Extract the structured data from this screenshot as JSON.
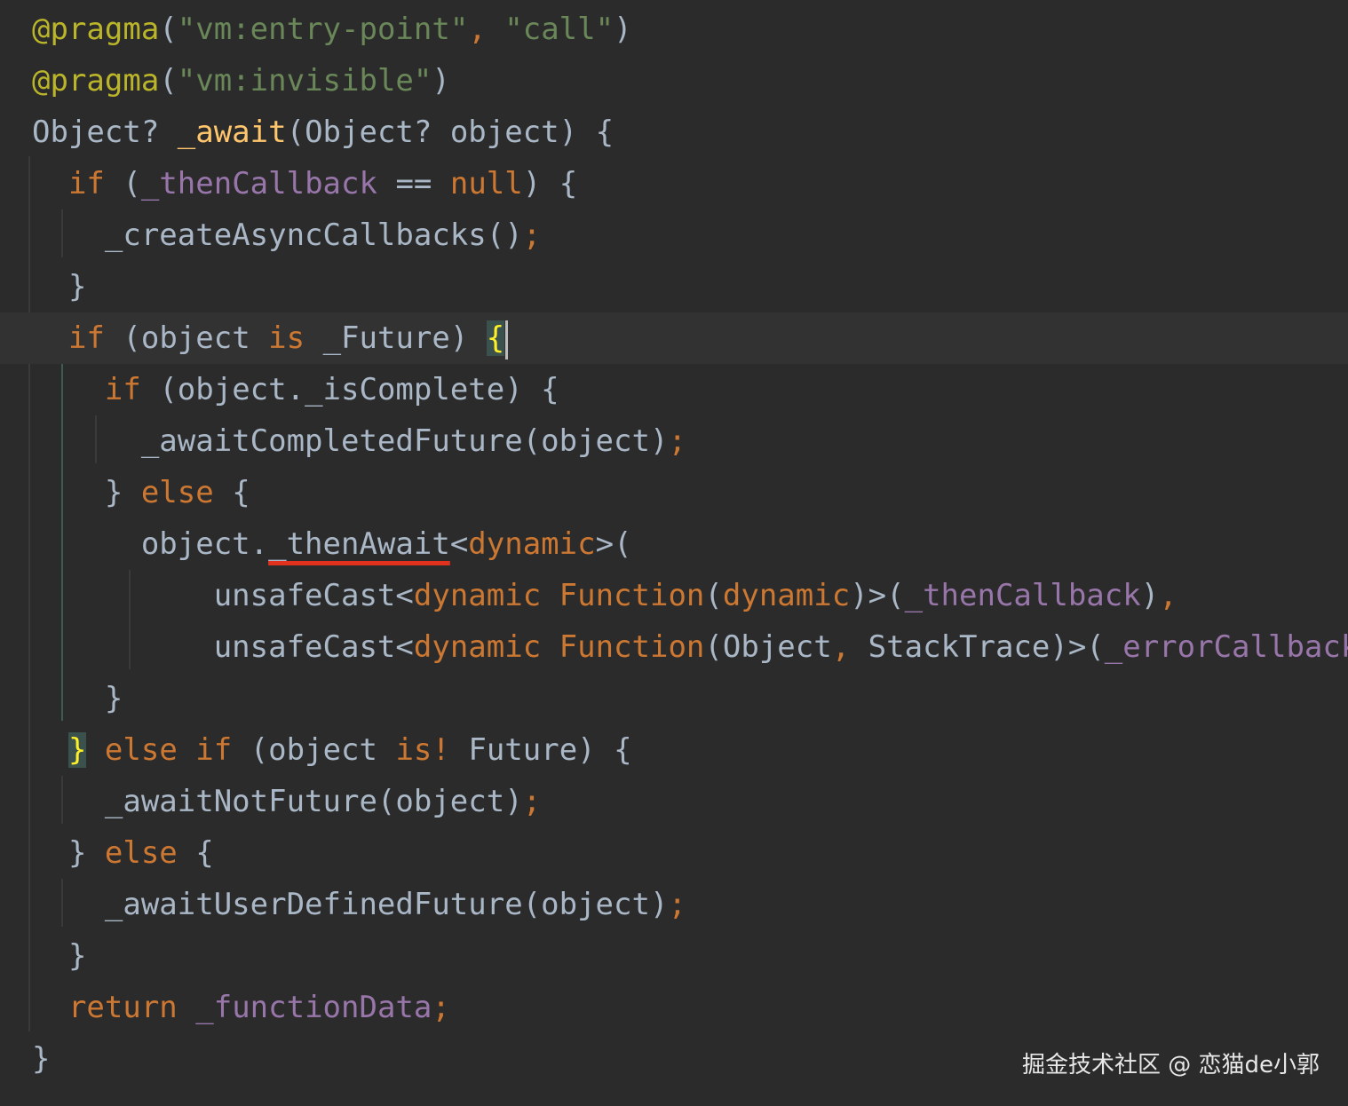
{
  "editor": {
    "language": "Dart",
    "theme_colors": {
      "background": "#2b2b2b",
      "default_text": "#a9b7c6",
      "keyword": "#cc7832",
      "string": "#6a8759",
      "annotation": "#bbb529",
      "function_name": "#ffc66d",
      "field": "#9876aa",
      "current_line": "#323232",
      "underline_mark": "#e0311f"
    },
    "lines": [
      {
        "tokens": [
          {
            "t": "@pragma",
            "c": "ann"
          },
          {
            "t": "(",
            "c": "tok"
          },
          {
            "t": "\"vm:entry-point\"",
            "c": "str"
          },
          {
            "t": ", ",
            "c": "kw"
          },
          {
            "t": "\"call\"",
            "c": "str"
          },
          {
            "t": ")",
            "c": "tok"
          }
        ]
      },
      {
        "tokens": [
          {
            "t": "@pragma",
            "c": "ann"
          },
          {
            "t": "(",
            "c": "tok"
          },
          {
            "t": "\"vm:invisible\"",
            "c": "str"
          },
          {
            "t": ")",
            "c": "tok"
          }
        ]
      },
      {
        "tokens": [
          {
            "t": "Object? ",
            "c": "tok"
          },
          {
            "t": "_await",
            "c": "fn"
          },
          {
            "t": "(Object? object) {",
            "c": "tok"
          }
        ]
      },
      {
        "tokens": [
          {
            "t": "  ",
            "c": "tok"
          },
          {
            "t": "if",
            "c": "kw"
          },
          {
            "t": " (",
            "c": "tok"
          },
          {
            "t": "_thenCallback",
            "c": "fld"
          },
          {
            "t": " == ",
            "c": "tok"
          },
          {
            "t": "null",
            "c": "kw"
          },
          {
            "t": ") {",
            "c": "tok"
          }
        ]
      },
      {
        "tokens": [
          {
            "t": "    _createAsyncCallbacks()",
            "c": "tok"
          },
          {
            "t": ";",
            "c": "kw"
          }
        ]
      },
      {
        "tokens": [
          {
            "t": "  }",
            "c": "tok"
          }
        ]
      },
      {
        "current": true,
        "tokens": [
          {
            "t": "  ",
            "c": "tok"
          },
          {
            "t": "if",
            "c": "kw"
          },
          {
            "t": " (object ",
            "c": "tok"
          },
          {
            "t": "is",
            "c": "kw"
          },
          {
            "t": " _Future) ",
            "c": "tok"
          },
          {
            "t": "{",
            "c": "match"
          },
          {
            "t": "",
            "c": "caret"
          }
        ]
      },
      {
        "tokens": [
          {
            "t": "    ",
            "c": "tok"
          },
          {
            "t": "if",
            "c": "kw"
          },
          {
            "t": " (object._isComplete) {",
            "c": "tok"
          }
        ]
      },
      {
        "tokens": [
          {
            "t": "      _awaitCompletedFuture(object)",
            "c": "tok"
          },
          {
            "t": ";",
            "c": "kw"
          }
        ]
      },
      {
        "tokens": [
          {
            "t": "    } ",
            "c": "tok"
          },
          {
            "t": "else",
            "c": "kw"
          },
          {
            "t": " {",
            "c": "tok"
          }
        ]
      },
      {
        "tokens": [
          {
            "t": "      object.",
            "c": "tok"
          },
          {
            "t": "_thenAwait",
            "c": "uline"
          },
          {
            "t": "<",
            "c": "tok"
          },
          {
            "t": "dynamic",
            "c": "kw"
          },
          {
            "t": ">(",
            "c": "tok"
          }
        ]
      },
      {
        "tokens": [
          {
            "t": "          unsafeCast<",
            "c": "tok"
          },
          {
            "t": "dynamic ",
            "c": "kw"
          },
          {
            "t": "Function",
            "c": "kw"
          },
          {
            "t": "(",
            "c": "tok"
          },
          {
            "t": "dynamic",
            "c": "kw"
          },
          {
            "t": ")>(",
            "c": "tok"
          },
          {
            "t": "_thenCallback",
            "c": "fld"
          },
          {
            "t": ")",
            "c": "tok"
          },
          {
            "t": ",",
            "c": "kw"
          }
        ]
      },
      {
        "tokens": [
          {
            "t": "          unsafeCast<",
            "c": "tok"
          },
          {
            "t": "dynamic ",
            "c": "kw"
          },
          {
            "t": "Function",
            "c": "kw"
          },
          {
            "t": "(Object",
            "c": "tok"
          },
          {
            "t": ", ",
            "c": "kw"
          },
          {
            "t": "StackTrace)>(",
            "c": "tok"
          },
          {
            "t": "_errorCallback",
            "c": "fld"
          },
          {
            "t": "))",
            "c": "tok"
          },
          {
            "t": ";",
            "c": "kw"
          }
        ]
      },
      {
        "tokens": [
          {
            "t": "    }",
            "c": "tok"
          }
        ]
      },
      {
        "tokens": [
          {
            "t": "  ",
            "c": "tok"
          },
          {
            "t": "}",
            "c": "match"
          },
          {
            "t": " ",
            "c": "tok"
          },
          {
            "t": "else if",
            "c": "kw"
          },
          {
            "t": " (object ",
            "c": "tok"
          },
          {
            "t": "is!",
            "c": "kw"
          },
          {
            "t": " Future) {",
            "c": "tok"
          }
        ]
      },
      {
        "tokens": [
          {
            "t": "    _awaitNotFuture(object)",
            "c": "tok"
          },
          {
            "t": ";",
            "c": "kw"
          }
        ]
      },
      {
        "tokens": [
          {
            "t": "  } ",
            "c": "tok"
          },
          {
            "t": "else",
            "c": "kw"
          },
          {
            "t": " {",
            "c": "tok"
          }
        ]
      },
      {
        "tokens": [
          {
            "t": "    _awaitUserDefinedFuture(object)",
            "c": "tok"
          },
          {
            "t": ";",
            "c": "kw"
          }
        ]
      },
      {
        "tokens": [
          {
            "t": "  }",
            "c": "tok"
          }
        ]
      },
      {
        "tokens": [
          {
            "t": "  ",
            "c": "tok"
          },
          {
            "t": "return",
            "c": "kw"
          },
          {
            "t": " ",
            "c": "tok"
          },
          {
            "t": "_functionData",
            "c": "fld"
          },
          {
            "t": ";",
            "c": "kw"
          }
        ]
      },
      {
        "tokens": [
          {
            "t": "}",
            "c": "tok"
          }
        ]
      }
    ]
  },
  "watermark": {
    "text": "掘金技术社区 @ 恋猫de小郭"
  }
}
